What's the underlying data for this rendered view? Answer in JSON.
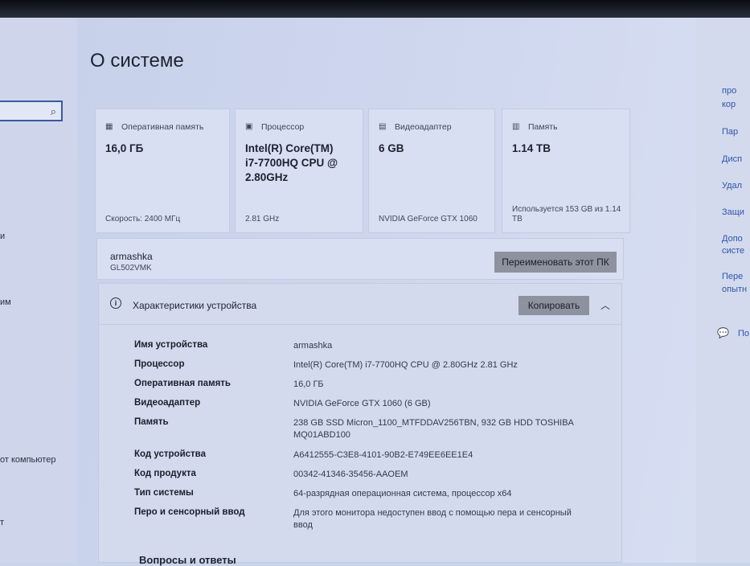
{
  "left_panel": {
    "fragments": [
      "и",
      "им",
      "от компьютер",
      "т"
    ]
  },
  "page": {
    "title": "О системе"
  },
  "cards": [
    {
      "icon": "ram-icon",
      "label": "Оперативная память",
      "value": "16,0 ГБ",
      "footer": "Скорость: 2400 МГц"
    },
    {
      "icon": "cpu-icon",
      "label": "Процессор",
      "value": "Intel(R) Core(TM) i7-7700HQ CPU @ 2.80GHz",
      "footer": "2.81 GHz"
    },
    {
      "icon": "gpu-icon",
      "label": "Видеоадаптер",
      "value": "6 GB",
      "footer": "NVIDIA GeForce GTX 1060"
    },
    {
      "icon": "storage-icon",
      "label": "Память",
      "value": "1.14 TB",
      "footer": "Используется 153 GB из 1.14 TB"
    }
  ],
  "device": {
    "name": "armashka",
    "model": "GL502VMK",
    "rename_button": "Переименовать этот ПК"
  },
  "specs": {
    "title": "Характеристики устройства",
    "copy_button": "Копировать",
    "rows": [
      {
        "key": "Имя устройства",
        "value": "armashka"
      },
      {
        "key": "Процессор",
        "value": "Intel(R) Core(TM) i7-7700HQ CPU @ 2.80GHz   2.81 GHz"
      },
      {
        "key": "Оперативная память",
        "value": "16,0 ГБ"
      },
      {
        "key": "Видеоадаптер",
        "value": "NVIDIA GeForce GTX 1060 (6 GB)"
      },
      {
        "key": "Память",
        "value": "238 GB SSD Micron_1100_MTFDDAV256TBN, 932 GB HDD TOSHIBA MQ01ABD100"
      },
      {
        "key": "Код устройства",
        "value": "A6412555-C3E8-4101-90B2-E749EE6EE1E4"
      },
      {
        "key": "Код продукта",
        "value": "00342-41346-35456-AAOEM"
      },
      {
        "key": "Тип системы",
        "value": "64-разрядная операционная система, процессор x64"
      },
      {
        "key": "Перо и сенсорный ввод",
        "value": "Для этого монитора недоступен ввод с помощью пера и сенсорный ввод"
      }
    ]
  },
  "faq": {
    "title": "Вопросы и ответы"
  },
  "right_panel": {
    "links": [
      "про",
      "кор",
      "Пар",
      "Дисп",
      "Удал",
      "Защи",
      "Допо",
      "систе",
      "Пере",
      "опытн",
      "По"
    ]
  }
}
